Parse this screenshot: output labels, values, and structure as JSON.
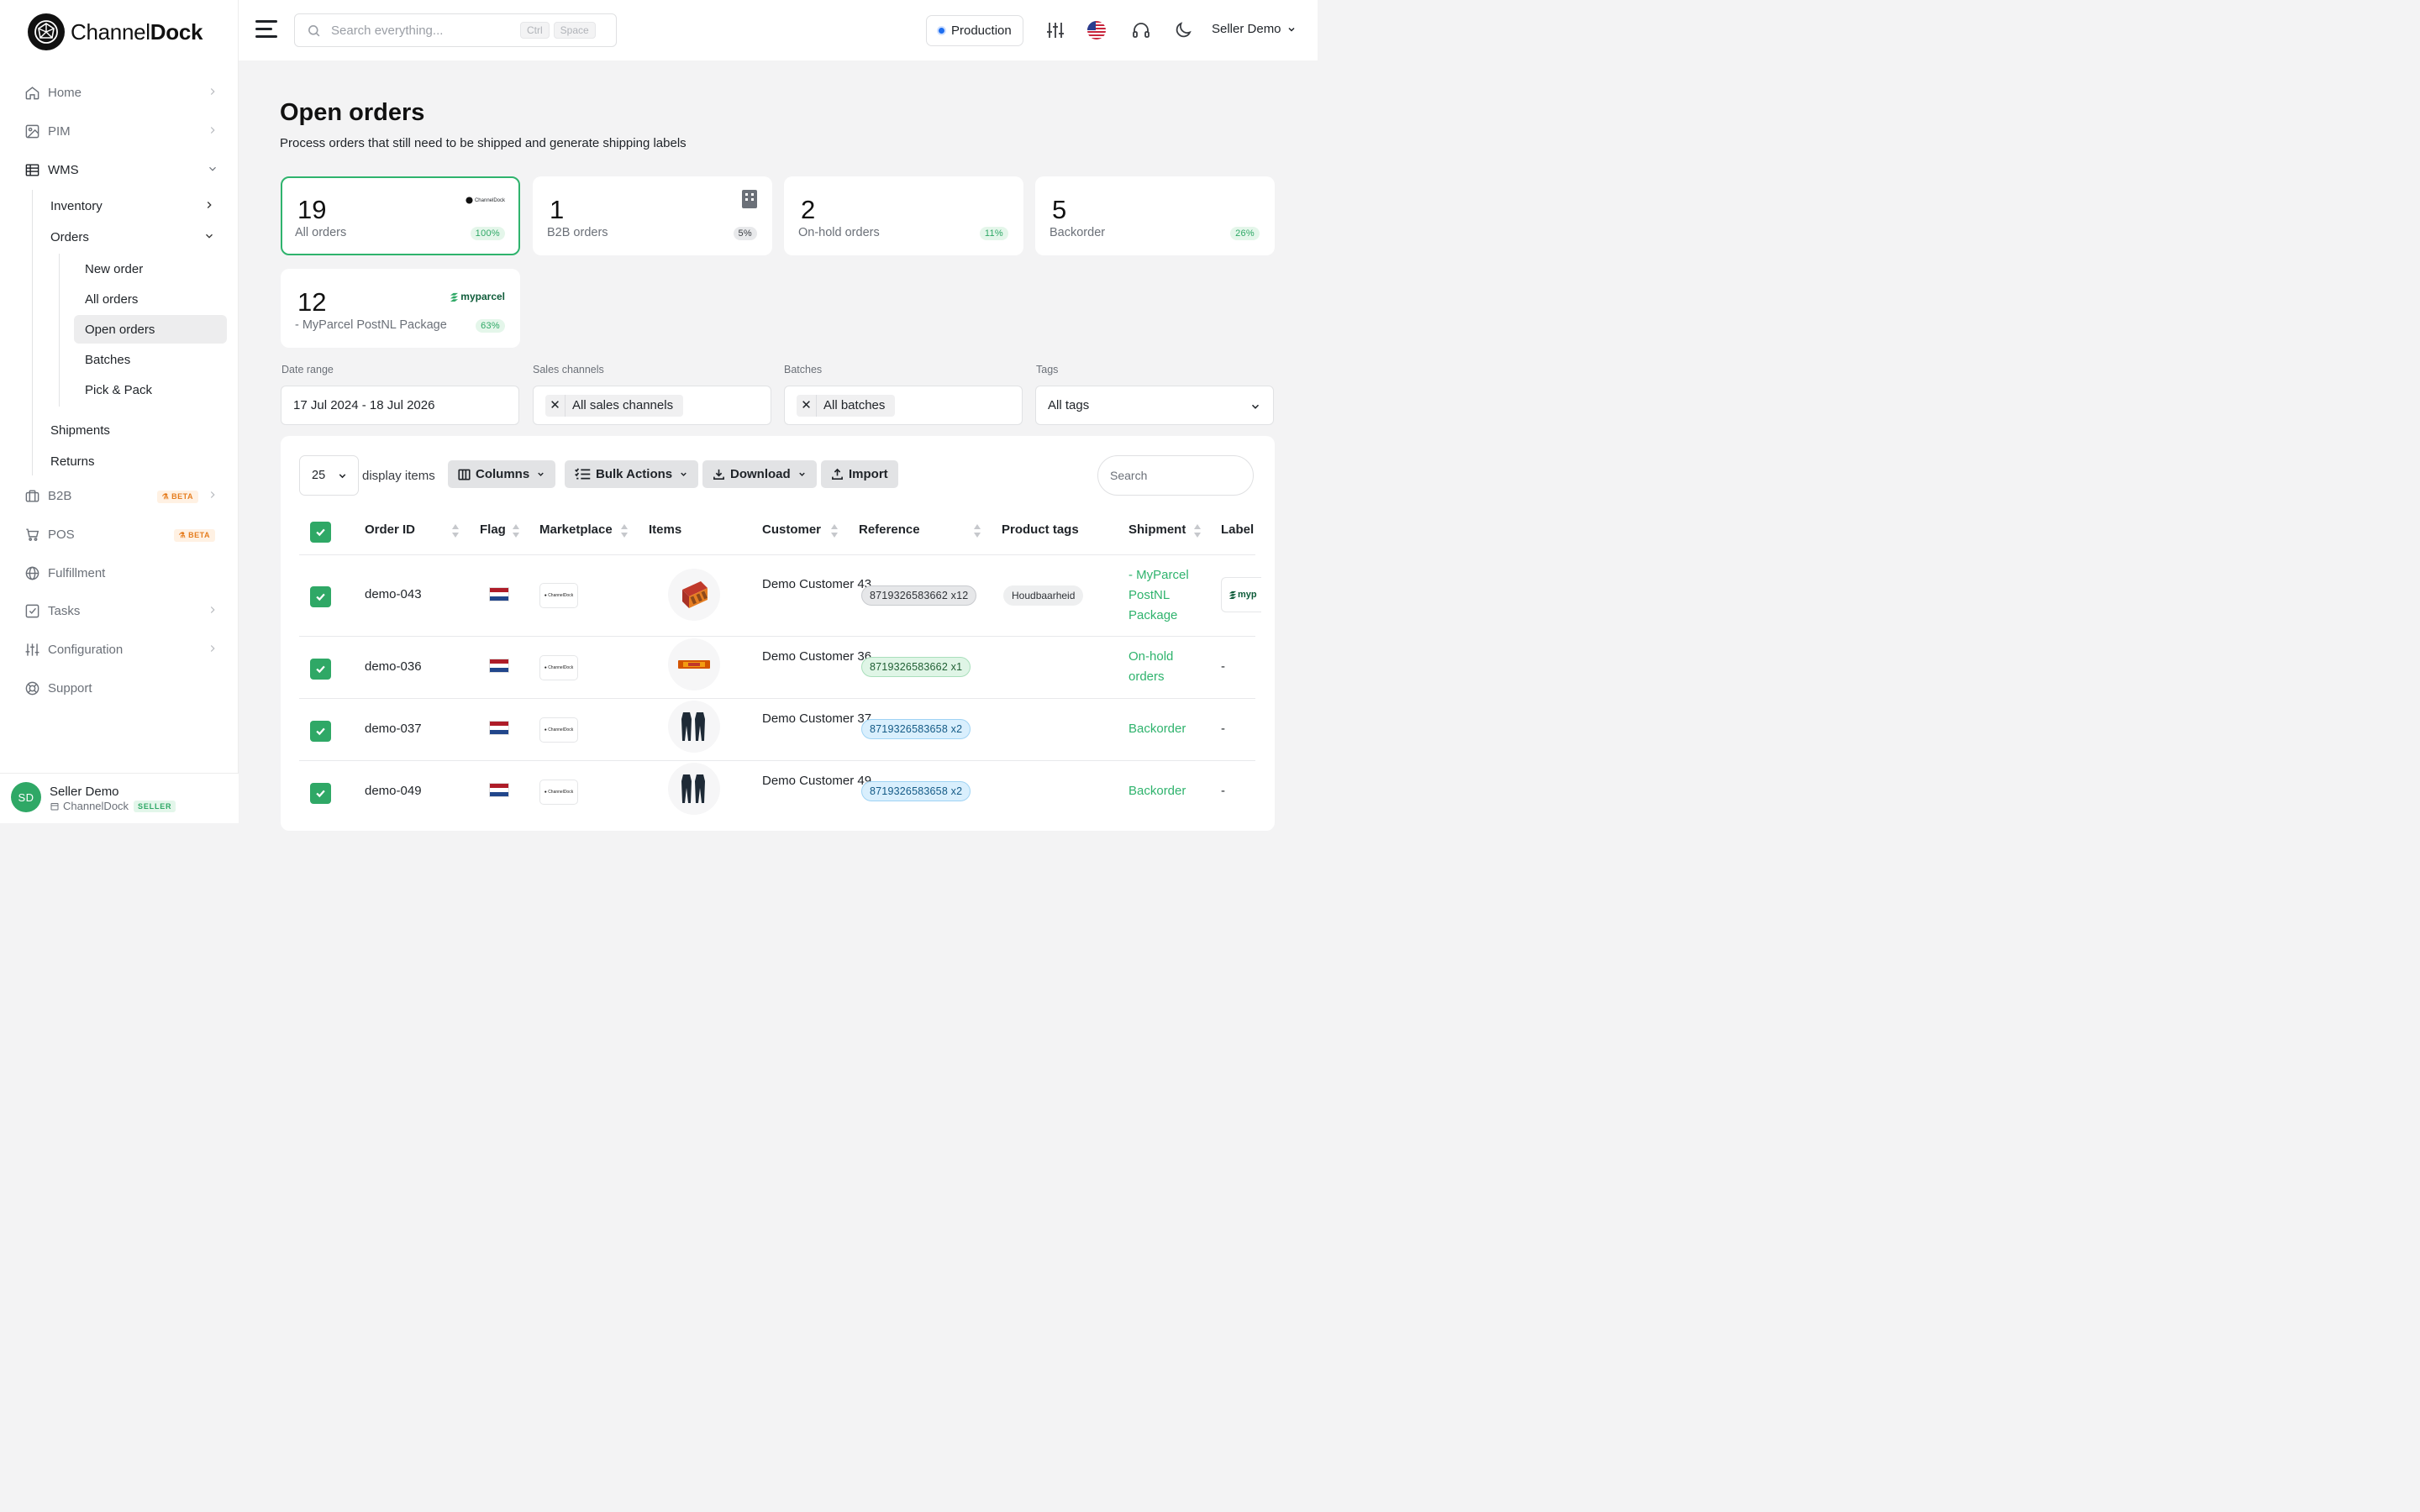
{
  "brand": {
    "name_light": "Channel",
    "name_bold": "Dock"
  },
  "sidebar": {
    "items": [
      {
        "label": "Home",
        "icon": "home-icon"
      },
      {
        "label": "PIM",
        "icon": "image-icon"
      },
      {
        "label": "WMS",
        "icon": "table-icon"
      },
      {
        "label": "B2B",
        "icon": "briefcase-icon",
        "badge": "BETA"
      },
      {
        "label": "POS",
        "icon": "cart-icon",
        "badge": "BETA"
      },
      {
        "label": "Fulfillment",
        "icon": "globe-icon"
      },
      {
        "label": "Tasks",
        "icon": "checkbox-icon"
      },
      {
        "label": "Configuration",
        "icon": "sliders-icon"
      },
      {
        "label": "Support",
        "icon": "lifebuoy-icon"
      }
    ],
    "wms_children": {
      "inventory": "Inventory",
      "orders": "Orders",
      "orders_children": [
        "New order",
        "All orders",
        "Open orders",
        "Batches",
        "Pick & Pack"
      ],
      "shipments": "Shipments",
      "returns": "Returns"
    },
    "active_item": "Open orders",
    "user": {
      "initials": "SD",
      "name": "Seller Demo",
      "company": "ChannelDock",
      "role": "SELLER"
    }
  },
  "topbar": {
    "search_placeholder": "Search everything...",
    "shortcut_keys": [
      "Ctrl",
      "Space"
    ],
    "environment": "Production",
    "user_menu": "Seller Demo"
  },
  "page": {
    "title": "Open orders",
    "subtitle": "Process orders that still need to be shipped and generate shipping labels"
  },
  "stats": [
    {
      "count": "19",
      "label": "All orders",
      "percent": "100%",
      "logo": "channeldock-logo",
      "selected": true
    },
    {
      "count": "1",
      "label": "B2B orders",
      "percent": "5%",
      "logo": "building-icon",
      "selected": false
    },
    {
      "count": "2",
      "label": "On-hold orders",
      "percent": "11%",
      "selected": false
    },
    {
      "count": "5",
      "label": "Backorder",
      "percent": "26%",
      "selected": false
    },
    {
      "count": "12",
      "label": "- MyParcel PostNL Package",
      "percent": "63%",
      "logo": "myparcel",
      "selected": false
    }
  ],
  "filters": {
    "date_range": {
      "label": "Date range",
      "value": "17 Jul 2024 - 18 Jul 2026"
    },
    "sales_channels": {
      "label": "Sales channels",
      "value": "All sales channels"
    },
    "batches": {
      "label": "Batches",
      "value": "All batches"
    },
    "tags": {
      "label": "Tags",
      "value": "All tags"
    }
  },
  "toolbar": {
    "per_page": "25",
    "per_page_label": "display items",
    "columns": "Columns",
    "bulk_actions": "Bulk Actions",
    "download": "Download",
    "import": "Import",
    "search_placeholder": "Search"
  },
  "table": {
    "columns": [
      "Order ID",
      "Flag",
      "Marketplace",
      "Items",
      "Customer",
      "Reference",
      "Product tags",
      "Shipment",
      "Label"
    ],
    "rows": [
      {
        "order_id": "demo-043",
        "flag": "NL",
        "customer": "Demo Customer 43",
        "reference": "8719326583662 x12",
        "ref_style": "gray",
        "tag": "Houdbaarheid",
        "shipment": "- MyParcel PostNL Package",
        "label": "myparcel",
        "item": "snack-box"
      },
      {
        "order_id": "demo-036",
        "flag": "NL",
        "customer": "Demo Customer 36",
        "reference": "8719326583662 x1",
        "ref_style": "green",
        "tag": "",
        "shipment": "On-hold orders",
        "label": "-",
        "item": "snack-bar"
      },
      {
        "order_id": "demo-037",
        "flag": "NL",
        "customer": "Demo Customer 37",
        "reference": "8719326583658 x2",
        "ref_style": "blue",
        "tag": "",
        "shipment": "Backorder",
        "label": "-",
        "item": "wetsuits"
      },
      {
        "order_id": "demo-049",
        "flag": "NL",
        "customer": "Demo Customer 49",
        "reference": "8719326583658 x2",
        "ref_style": "blue",
        "tag": "",
        "shipment": "Backorder",
        "label": "-",
        "item": "wetsuits"
      }
    ]
  },
  "colors": {
    "accent": "#2fb36d",
    "env_dot": "#1e6ef0",
    "beta": "#e57d1f"
  }
}
